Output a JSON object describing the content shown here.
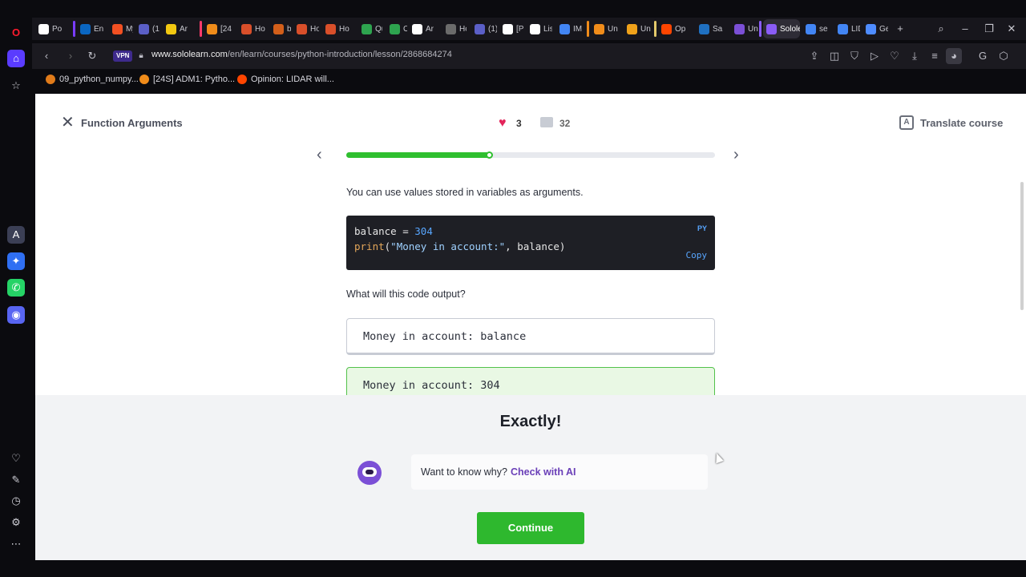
{
  "browser": {
    "tabs": [
      {
        "label": "Po",
        "color": "#ffffff"
      },
      {
        "label": "En",
        "color": "#0a66c2"
      },
      {
        "label": "My",
        "color": "#f25022"
      },
      {
        "label": "(1)",
        "color": "#5b5fc7"
      },
      {
        "label": "Ar",
        "color": "#f2c811"
      },
      {
        "label": "[24",
        "color": "#f08c1a"
      },
      {
        "label": "Ho",
        "color": "#d94f2a"
      },
      {
        "label": "bir",
        "color": "#d35f1a"
      },
      {
        "label": "Ho",
        "color": "#d94f2a"
      },
      {
        "label": "Ho",
        "color": "#d94f2a"
      },
      {
        "label": "Qu",
        "color": "#2ea44f"
      },
      {
        "label": "OS",
        "color": "#2ea44f"
      },
      {
        "label": "Ar",
        "color": "#ffffff"
      },
      {
        "label": "Ho",
        "color": "#6b6b6b"
      },
      {
        "label": "(1)",
        "color": "#5b5fc7"
      },
      {
        "label": "[Pl",
        "color": "#ffffff"
      },
      {
        "label": "Lis",
        "color": "#ffffff"
      },
      {
        "label": "IM",
        "color": "#4285f4"
      },
      {
        "label": "Un",
        "color": "#f08c1a"
      },
      {
        "label": "Un",
        "color": "#f0a21a"
      },
      {
        "label": "Op",
        "color": "#ff4500"
      },
      {
        "label": "Sa",
        "color": "#1f70c1"
      },
      {
        "label": "Un",
        "color": "#7b4fd6"
      },
      {
        "label": "Sololea",
        "color": "#8a5cf6"
      },
      {
        "label": "se",
        "color": "#4285f4"
      },
      {
        "label": "LID",
        "color": "#4285f4"
      },
      {
        "label": "Ge",
        "color": "#4e8cff"
      }
    ],
    "vpn_label": "VPN",
    "url_host": "www.sololearn.com",
    "url_path": "/en/learn/courses/python-introduction/lesson/2868684274",
    "bookmarks": [
      {
        "label": "09_python_numpy...",
        "color": "#e07b1a"
      },
      {
        "label": "[24S] ADM1: Pytho...",
        "color": "#f08c1a"
      },
      {
        "label": "Opinion: LIDAR will...",
        "color": "#ff4500"
      }
    ]
  },
  "lesson": {
    "title": "Function Arguments",
    "likes": "3",
    "comments": "32",
    "translate_label": "Translate course",
    "progress": 0.39,
    "intro": "You can use values stored in variables as arguments.",
    "code": {
      "lang": "PY",
      "copy_label": "Copy",
      "line1": {
        "var": "balance",
        "op": " = ",
        "num": "304"
      },
      "line2": {
        "fn": "print",
        "open": "(",
        "str": "\"Money in account:\"",
        "rest": ", balance)"
      }
    },
    "question": "What will this code output?",
    "options": [
      {
        "text": "Money in account: balance",
        "correct": false
      },
      {
        "text": "Money in account: 304",
        "correct": true
      }
    ]
  },
  "feedback": {
    "title": "Exactly!",
    "ai_prompt": "Want to know why?",
    "ai_link": "Check with AI",
    "continue_label": "Continue"
  },
  "colors": {
    "accent_green": "#2eb82e",
    "ai_purple": "#6a3fb8",
    "heart": "#e3245a"
  }
}
